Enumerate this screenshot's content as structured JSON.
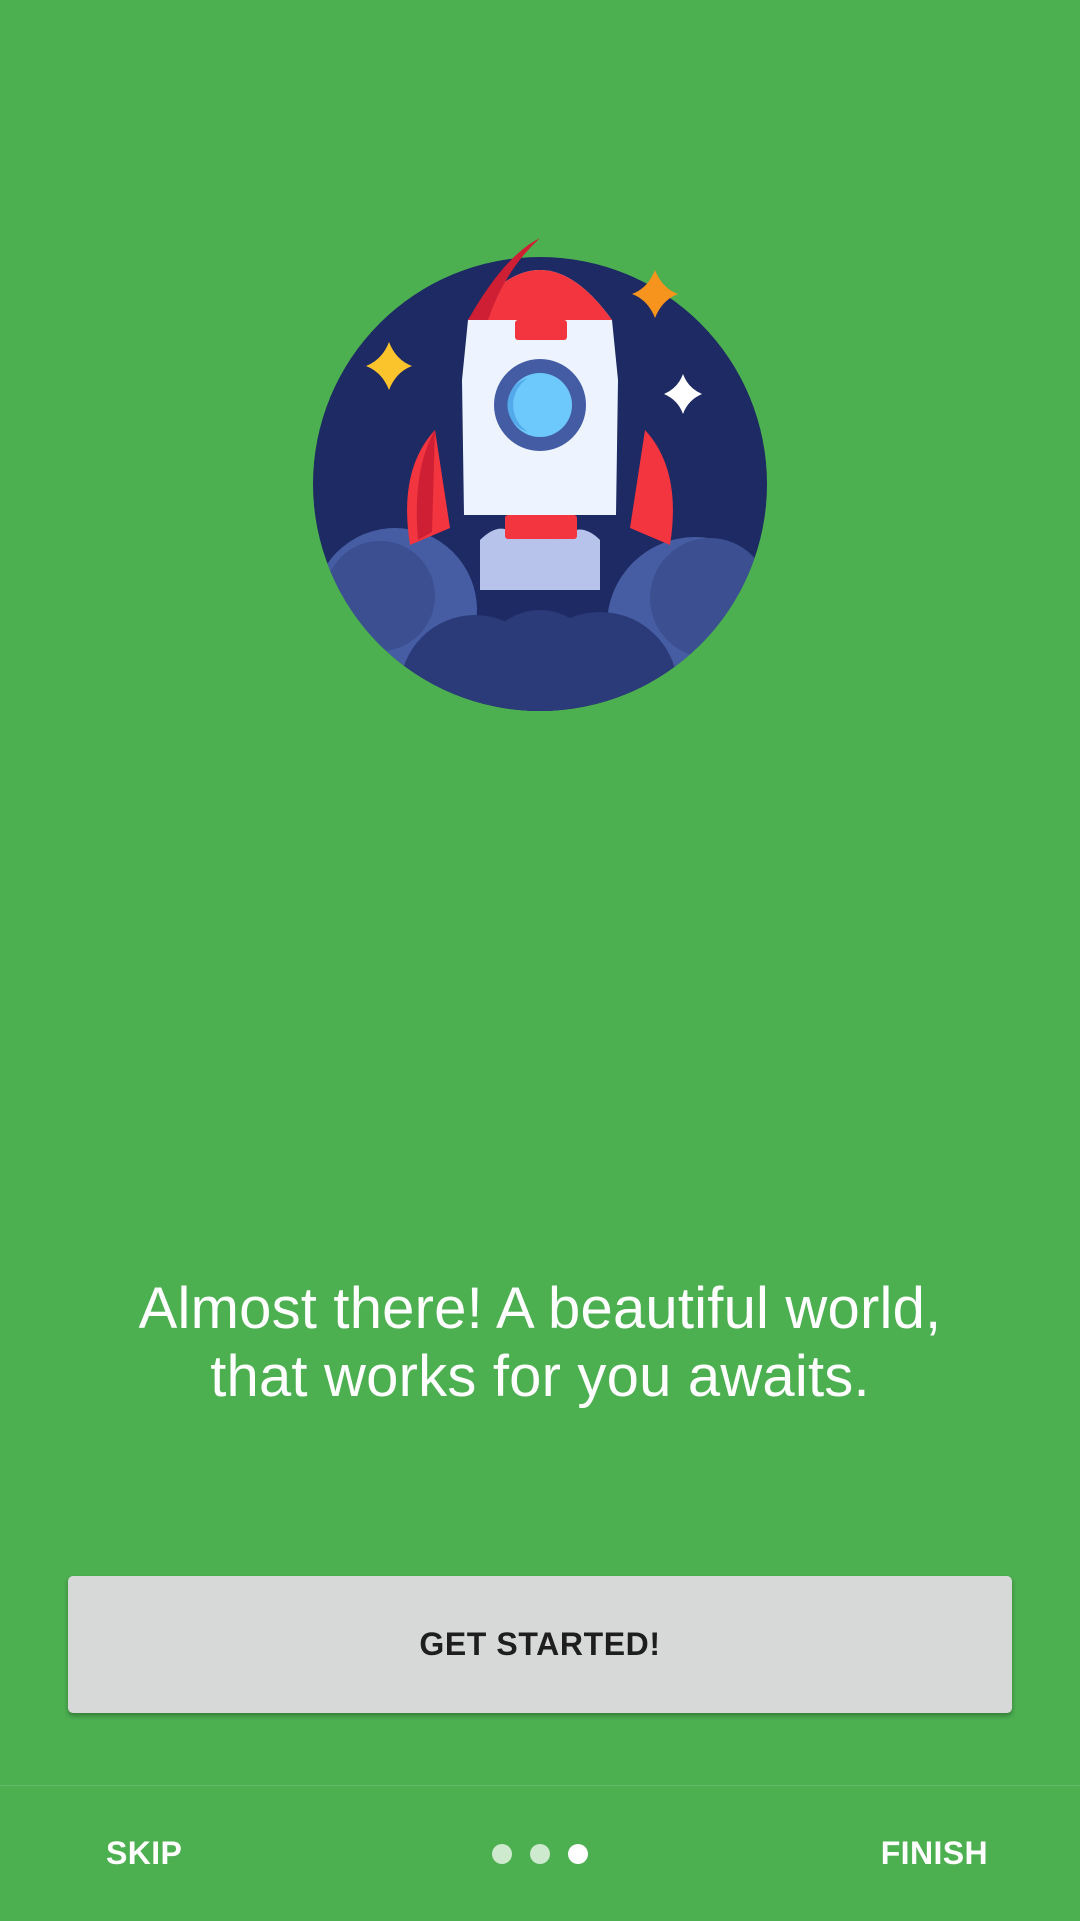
{
  "onboarding": {
    "headline_line1": "Almost there! A beautiful world,",
    "headline_line2": "that works for you awaits.",
    "illustration_icon": "rocket-launch-icon",
    "cta_label": "GET STARTED!"
  },
  "navigation": {
    "skip_label": "SKIP",
    "finish_label": "FINISH",
    "page_count": 3,
    "current_page": 3
  },
  "colors": {
    "background": "#4caf50",
    "button_background": "#d7d8d8",
    "button_text": "#1e1e1e",
    "illustration_circle": "#1d2a63",
    "rocket_red": "#f2353f",
    "star_yellow": "#fcc42c",
    "star_orange": "#f7941d"
  }
}
